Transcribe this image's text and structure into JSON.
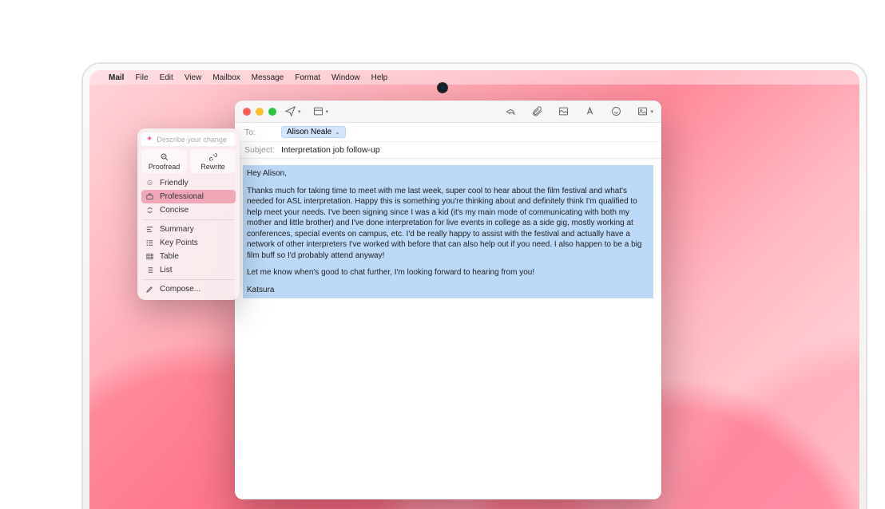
{
  "menubar": {
    "apple": "",
    "app": "Mail",
    "items": [
      "File",
      "Edit",
      "View",
      "Mailbox",
      "Message",
      "Format",
      "Window",
      "Help"
    ]
  },
  "mail": {
    "toLabel": "To:",
    "toToken": "Alison Neale",
    "subjectLabel": "Subject:",
    "subjectValue": "Interpretation job follow-up",
    "greeting": "Hey Alison,",
    "para1": "Thanks much for taking time to meet with me last week, super cool to hear about the film festival and what's needed for ASL interpretation. Happy this is something you're thinking about and definitely think I'm qualified to help meet your needs. I've been signing since I was a kid (it's my main mode of communicating with both my mother and little brother) and I've done interpretation for  live events in college as a side gig, mostly working at conferences, special events on campus, etc. I'd be really happy to assist with the festival and actually have a network of other interpreters I've worked with before that can also help out if you need. I also happen to be a big film buff so I'd probably attend anyway!",
    "para2": "Let me know when's good to chat further, I'm looking forward to hearing from you!",
    "signature": "Katsura"
  },
  "ai": {
    "placeholder": "Describe your change",
    "proofread": "Proofread",
    "rewrite": "Rewrite",
    "tones": {
      "friendly": "Friendly",
      "professional": "Professional",
      "concise": "Concise"
    },
    "formats": {
      "summary": "Summary",
      "keypoints": "Key Points",
      "table": "Table",
      "list": "List"
    },
    "compose": "Compose..."
  }
}
